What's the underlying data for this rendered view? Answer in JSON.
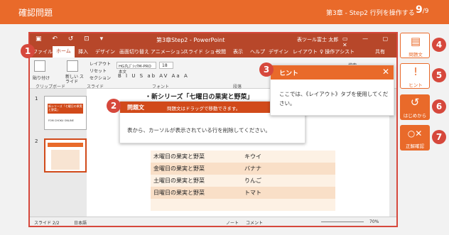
{
  "header": {
    "title": "確認問題",
    "chapter": "第3章 - Step2 行列を操作する",
    "page": "9",
    "total": "/9"
  },
  "ppt": {
    "title": "第3章Step2 - PowerPoint",
    "table_tools": "表ツール",
    "user": "富士 太郎",
    "quick_icons": "▣ ↶ ↺ ⊡ ▾",
    "window_icons": "▭ — ▢ ✕"
  },
  "tabs": [
    "ファイル",
    "ホーム",
    "挿入",
    "デザイン",
    "画面切り替え",
    "アニメーション",
    "スライド ショー",
    "校閲",
    "表示",
    "ヘルプ",
    "デザイン",
    "レイアウト",
    "♀ 操作アシスト",
    "共有"
  ],
  "ribbon": {
    "paste": "貼り付け",
    "clipboard": "クリップボード",
    "new_slide": "新しい スライド",
    "slides": "スライド",
    "layout": "レイアウト",
    "reset": "リセット",
    "section": "セクション",
    "font_name": "HG丸ｺﾞｼｯｸM-PRO 本文",
    "font_size": "18",
    "font_group": "フォント",
    "para_group": "段落",
    "search": "検索",
    "font_buttons": "B I U S ab AV Aa A"
  },
  "thumbs": [
    {
      "num": "1",
      "title": "新シリーズ「七曜日の果実と野菜」",
      "sub": "FOM CHOKU ONLINE"
    },
    {
      "num": "2"
    }
  ],
  "slide": {
    "heading": "・新シリーズ「七曜日の果実と野菜」",
    "rows": [
      [
        "木曜日の果実と野菜",
        "キウイ"
      ],
      [
        "金曜日の果実と野菜",
        "バナナ"
      ],
      [
        "土曜日の果実と野菜",
        "りんご"
      ],
      [
        "日曜日の果実と野菜",
        "トマト"
      ]
    ]
  },
  "status": {
    "slide": "スライド 2/2",
    "lang": "日本語",
    "notes": "ノート",
    "comments": "コメント",
    "zoom": "70%"
  },
  "hint": {
    "title": "ヒント",
    "close": "✕",
    "body": "ここでは、《レイアウト》タブを使用してください。"
  },
  "question": {
    "title": "問題文",
    "drag": "問題文はドラッグで移動できます。",
    "body": "表から、カーソルが表示されている行を削除してください。"
  },
  "markers": [
    "1",
    "2",
    "3",
    "4",
    "5",
    "6",
    "7"
  ],
  "side": [
    {
      "icon": "▤",
      "label": "問題文"
    },
    {
      "icon": "!",
      "label": "ヒント"
    },
    {
      "icon": "↺",
      "label": "はじめから"
    },
    {
      "icon": "○✕",
      "label": "正解確認"
    }
  ],
  "colors": {
    "accent": "#e96a2a",
    "ppt_red": "#b7472a",
    "marker": "#d6483c"
  }
}
